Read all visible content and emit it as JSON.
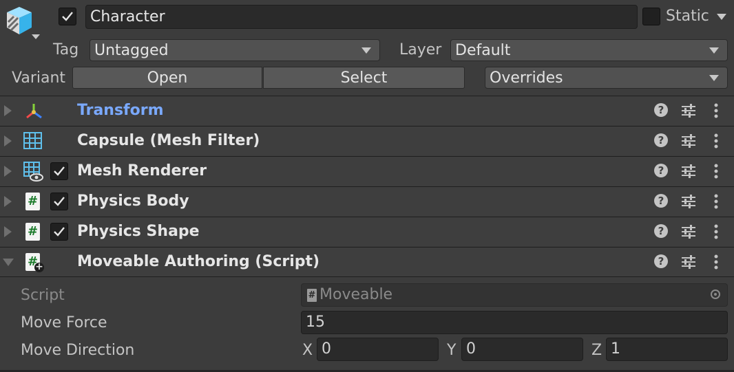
{
  "header": {
    "name": "Character",
    "active_checked": true,
    "static_label": "Static",
    "static_checked": false,
    "tag_label": "Tag",
    "tag_value": "Untagged",
    "layer_label": "Layer",
    "layer_value": "Default",
    "variant_label": "Variant",
    "open_label": "Open",
    "select_label": "Select",
    "overrides_label": "Overrides"
  },
  "components": [
    {
      "name": "Transform",
      "icon": "transform-icon",
      "has_toggle": false,
      "expanded": false,
      "accent": "#7aa9ff"
    },
    {
      "name": "Capsule (Mesh Filter)",
      "icon": "mesh-filter-icon",
      "has_toggle": false,
      "expanded": false
    },
    {
      "name": "Mesh Renderer",
      "icon": "mesh-renderer-icon",
      "has_toggle": true,
      "checked": true,
      "expanded": false
    },
    {
      "name": "Physics Body",
      "icon": "script-icon",
      "has_toggle": true,
      "checked": true,
      "expanded": false
    },
    {
      "name": "Physics Shape",
      "icon": "script-icon",
      "has_toggle": true,
      "checked": true,
      "expanded": false
    },
    {
      "name": "Moveable Authoring (Script)",
      "icon": "script-add-icon",
      "has_toggle": false,
      "expanded": true
    }
  ],
  "properties": {
    "script_label": "Script",
    "script_value": "Moveable",
    "move_force_label": "Move Force",
    "move_force_value": "15",
    "move_direction_label": "Move Direction",
    "x_label": "X",
    "x_value": "0",
    "y_label": "Y",
    "y_value": "0",
    "z_label": "Z",
    "z_value": "1"
  },
  "colors": {
    "background": "#3c3c3c",
    "transform_title": "#7aa9ff",
    "field": "#2a2a2a",
    "button": "#585858"
  }
}
